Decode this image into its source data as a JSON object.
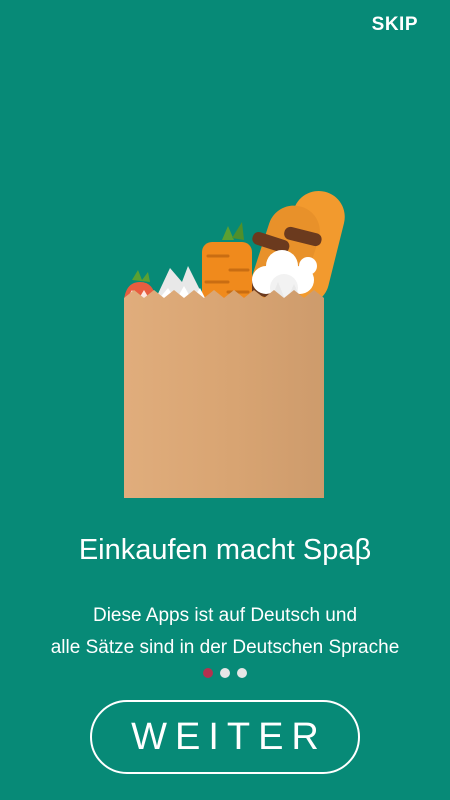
{
  "header": {
    "skip_label": "SKIP"
  },
  "onboarding": {
    "title": "Einkaufen macht Spaβ",
    "description_line1": "Diese Apps ist auf Deutsch und",
    "description_line2": "alle Sätze sind in der Deutschen Sprache",
    "page_indicator": {
      "total": 3,
      "active_index": 0
    },
    "illustration_icon": "grocery-bag-icon"
  },
  "footer": {
    "next_label": "WEITER"
  },
  "colors": {
    "background": "#078a77",
    "bag": "#d9a877",
    "dot_active": "#b4314f",
    "dot_inactive": "#e6e6e6",
    "text": "#ffffff"
  }
}
